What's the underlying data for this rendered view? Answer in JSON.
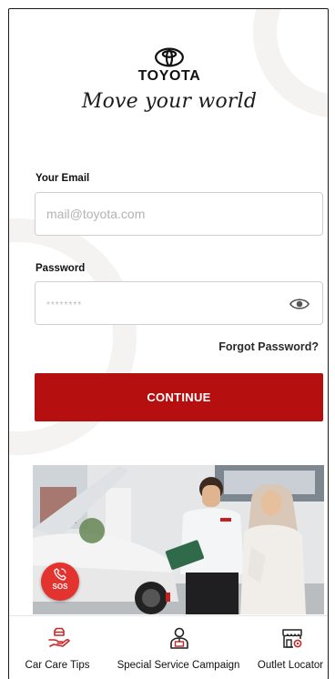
{
  "brand": {
    "name": "TOYOTA",
    "tagline": "Move your world"
  },
  "login": {
    "email_label": "Your Email",
    "email_placeholder": "mail@toyota.com",
    "password_label": "Password",
    "password_placeholder": "********",
    "forgot_label": "Forgot Password?",
    "continue_label": "CONTINUE"
  },
  "sos": {
    "label": "SOS"
  },
  "bottom_nav": {
    "items": [
      {
        "label": "Car Care Tips",
        "icon": "car-care-hand-icon"
      },
      {
        "label": "Special Service Campaign",
        "icon": "service-advisor-icon"
      },
      {
        "label": "Outlet Locator",
        "icon": "outlet-store-icon"
      }
    ]
  },
  "colors": {
    "accent": "#b50f0f",
    "sos": "#e2332f",
    "text": "#111111",
    "border": "#cfcfcf"
  },
  "icons": [
    "toyota-logo-icon",
    "eye-icon",
    "phone-icon"
  ]
}
